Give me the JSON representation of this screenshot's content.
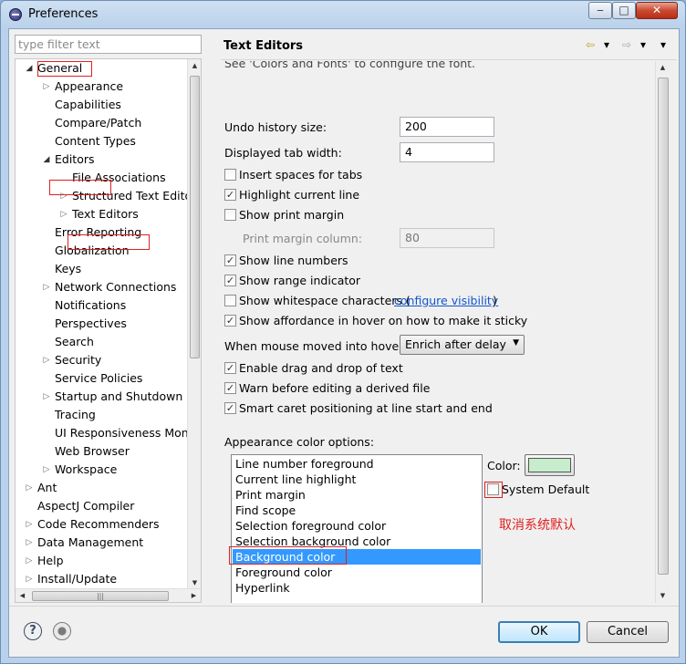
{
  "window": {
    "title": "Preferences",
    "min": "‒",
    "max": "□",
    "close": "✕"
  },
  "filter": {
    "placeholder": "type filter text"
  },
  "tree": {
    "items": [
      {
        "label": "General",
        "twisty": "◢"
      },
      {
        "label": "Appearance",
        "twisty": "▷"
      },
      {
        "label": "Capabilities",
        "twisty": ""
      },
      {
        "label": "Compare/Patch",
        "twisty": ""
      },
      {
        "label": "Content Types",
        "twisty": ""
      },
      {
        "label": "Editors",
        "twisty": "◢"
      },
      {
        "label": "File Associations",
        "twisty": ""
      },
      {
        "label": "Structured Text Editors",
        "twisty": "▷"
      },
      {
        "label": "Text Editors",
        "twisty": "▷"
      },
      {
        "label": "Error Reporting",
        "twisty": ""
      },
      {
        "label": "Globalization",
        "twisty": ""
      },
      {
        "label": "Keys",
        "twisty": ""
      },
      {
        "label": "Network Connections",
        "twisty": "▷"
      },
      {
        "label": "Notifications",
        "twisty": ""
      },
      {
        "label": "Perspectives",
        "twisty": ""
      },
      {
        "label": "Search",
        "twisty": ""
      },
      {
        "label": "Security",
        "twisty": "▷"
      },
      {
        "label": "Service Policies",
        "twisty": ""
      },
      {
        "label": "Startup and Shutdown",
        "twisty": "▷"
      },
      {
        "label": "Tracing",
        "twisty": ""
      },
      {
        "label": "UI Responsiveness Monitoring",
        "twisty": ""
      },
      {
        "label": "Web Browser",
        "twisty": ""
      },
      {
        "label": "Workspace",
        "twisty": "▷"
      },
      {
        "label": "Ant",
        "twisty": "▷"
      },
      {
        "label": "AspectJ Compiler",
        "twisty": ""
      },
      {
        "label": "Code Recommenders",
        "twisty": "▷"
      },
      {
        "label": "Data Management",
        "twisty": "▷"
      },
      {
        "label": "Help",
        "twisty": "▷"
      },
      {
        "label": "Install/Update",
        "twisty": "▷"
      }
    ]
  },
  "right": {
    "title": "Text Editors",
    "partial_line": "See 'Colors and Fonts' to configure the font.",
    "undo_label": "Undo history size:",
    "undo_value": "200",
    "tab_label": "Displayed tab width:",
    "tab_value": "4",
    "checkboxes": [
      {
        "label": "Insert spaces for tabs",
        "checked": false
      },
      {
        "label": "Highlight current line",
        "checked": true
      },
      {
        "label": "Show print margin",
        "checked": false
      }
    ],
    "print_margin_label": "Print margin column:",
    "print_margin_value": "80",
    "checkboxes2": [
      {
        "label": "Show line numbers",
        "checked": true
      },
      {
        "label": "Show range indicator",
        "checked": true
      },
      {
        "label": "Show whitespace characters (",
        "checked": false
      },
      {
        "label": "Show affordance in hover on how to make it sticky",
        "checked": true
      }
    ],
    "configure_visibility": "configure visibility",
    "hover_label": "When mouse moved into hover:",
    "hover_value": "Enrich after delay",
    "checkboxes3": [
      {
        "label": "Enable drag and drop of text",
        "checked": true
      },
      {
        "label": "Warn before editing a derived file",
        "checked": true
      },
      {
        "label": "Smart caret positioning at line start and end",
        "checked": true
      }
    ],
    "appearance_label": "Appearance color options:",
    "color_options": [
      "Line number foreground",
      "Current line highlight",
      "Print margin",
      "Find scope",
      "Selection foreground color",
      "Selection background color",
      "Background color",
      "Foreground color",
      "Hyperlink"
    ],
    "selected_index": 6,
    "color_label": "Color:",
    "color_value": "#c7edcc",
    "system_default": "System Default",
    "annotation": "取消系统默认"
  },
  "buttons": {
    "ok": "OK",
    "cancel": "Cancel",
    "help": "?"
  }
}
